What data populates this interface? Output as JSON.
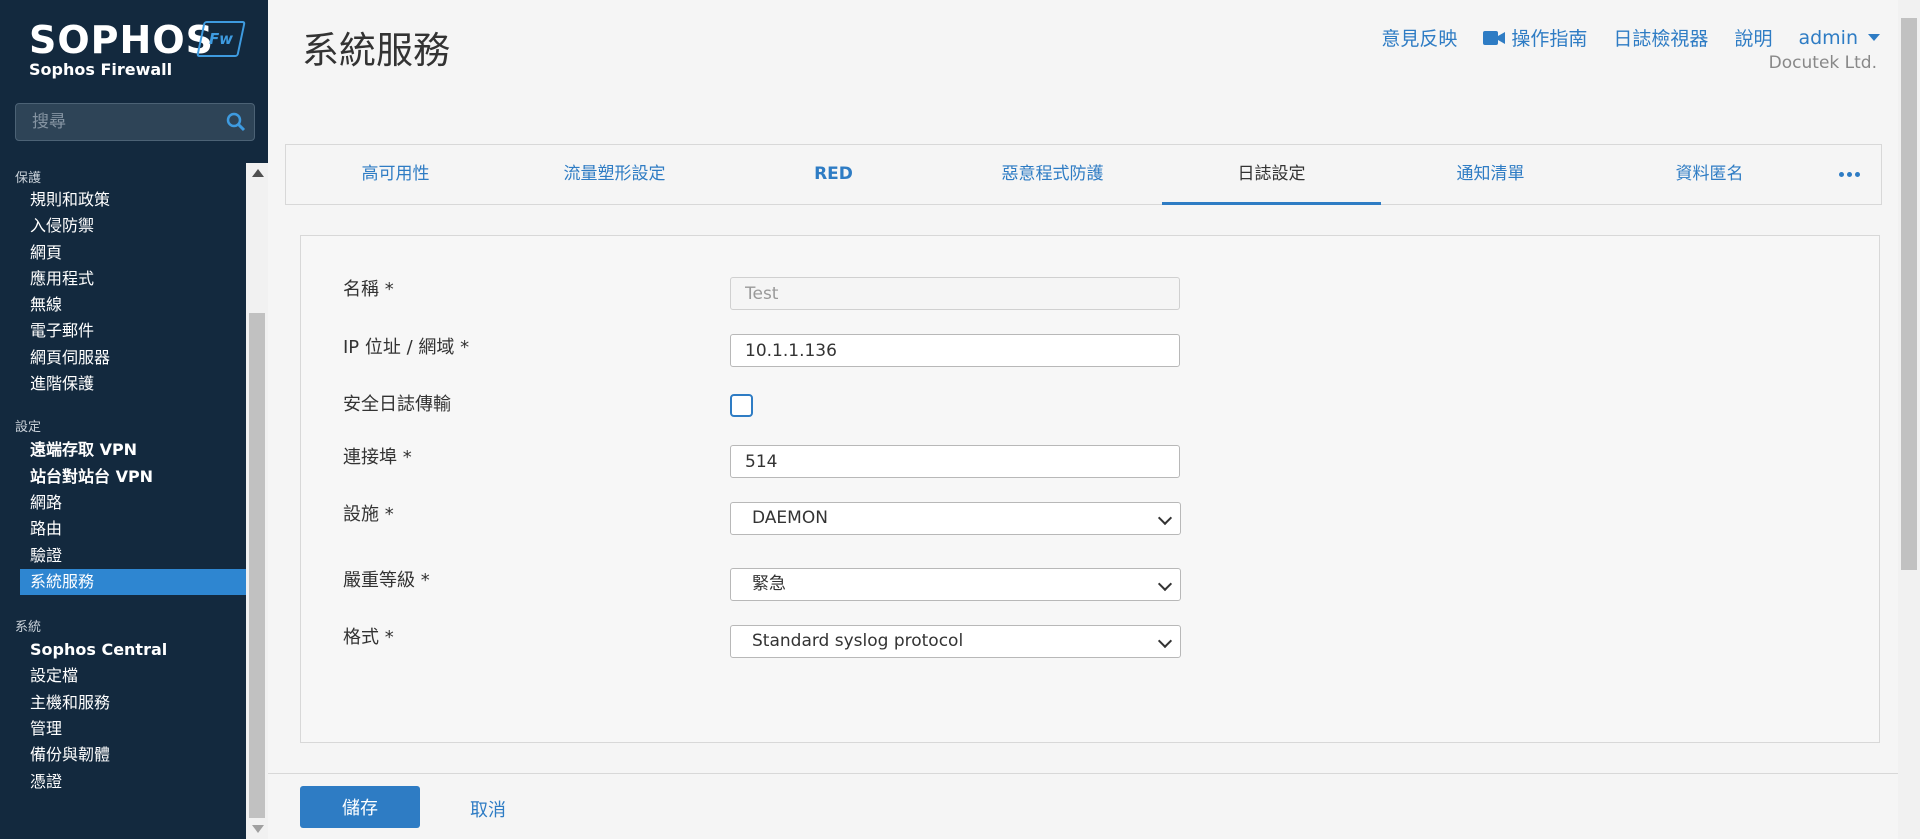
{
  "brand": {
    "name": "SOPHOS",
    "badge": "Fw",
    "product": "Sophos Firewall"
  },
  "search": {
    "placeholder": "搜尋"
  },
  "sidebar": {
    "groups": [
      {
        "label": "保護",
        "items": [
          "規則和政策",
          "入侵防禦",
          "網頁",
          "應用程式",
          "無線",
          "電子郵件",
          "網頁伺服器",
          "進階保護"
        ]
      },
      {
        "label": "設定",
        "items": [
          "遠端存取 VPN",
          "站台對站台 VPN",
          "網路",
          "路由",
          "驗證",
          "系統服務"
        ]
      },
      {
        "label": "系統",
        "items": [
          "Sophos Central",
          "設定檔",
          "主機和服務",
          "管理",
          "備份與韌體",
          "憑證"
        ]
      }
    ],
    "active_item": "系統服務"
  },
  "header": {
    "title": "系統服務",
    "links": {
      "feedback": "意見反映",
      "guide": "操作指南",
      "log_viewer": "日誌檢視器",
      "help": "說明",
      "user": "admin"
    },
    "org": "Docutek Ltd."
  },
  "tabs": [
    {
      "label": "高可用性"
    },
    {
      "label": "流量塑形設定"
    },
    {
      "label": "RED"
    },
    {
      "label": "惡意程式防護"
    },
    {
      "label": "日誌設定"
    },
    {
      "label": "通知清單"
    },
    {
      "label": "資料匿名"
    }
  ],
  "form": {
    "name_label": "名稱 *",
    "name_value": "Test",
    "ip_label": "IP 位址 / 網域 *",
    "ip_value": "10.1.1.136",
    "secure_label": "安全日誌傳輸",
    "port_label": "連接埠 *",
    "port_value": "514",
    "facility_label": "設施 *",
    "facility_value": "DAEMON",
    "severity_label": "嚴重等級 *",
    "severity_value": "緊急",
    "format_label": "格式 *",
    "format_value": "Standard syslog protocol"
  },
  "footer": {
    "save": "儲存",
    "cancel": "取消"
  },
  "colors": {
    "accent": "#2e7cc4",
    "sidebar_bg": "#13293e",
    "active_nav": "#2e86d1"
  }
}
